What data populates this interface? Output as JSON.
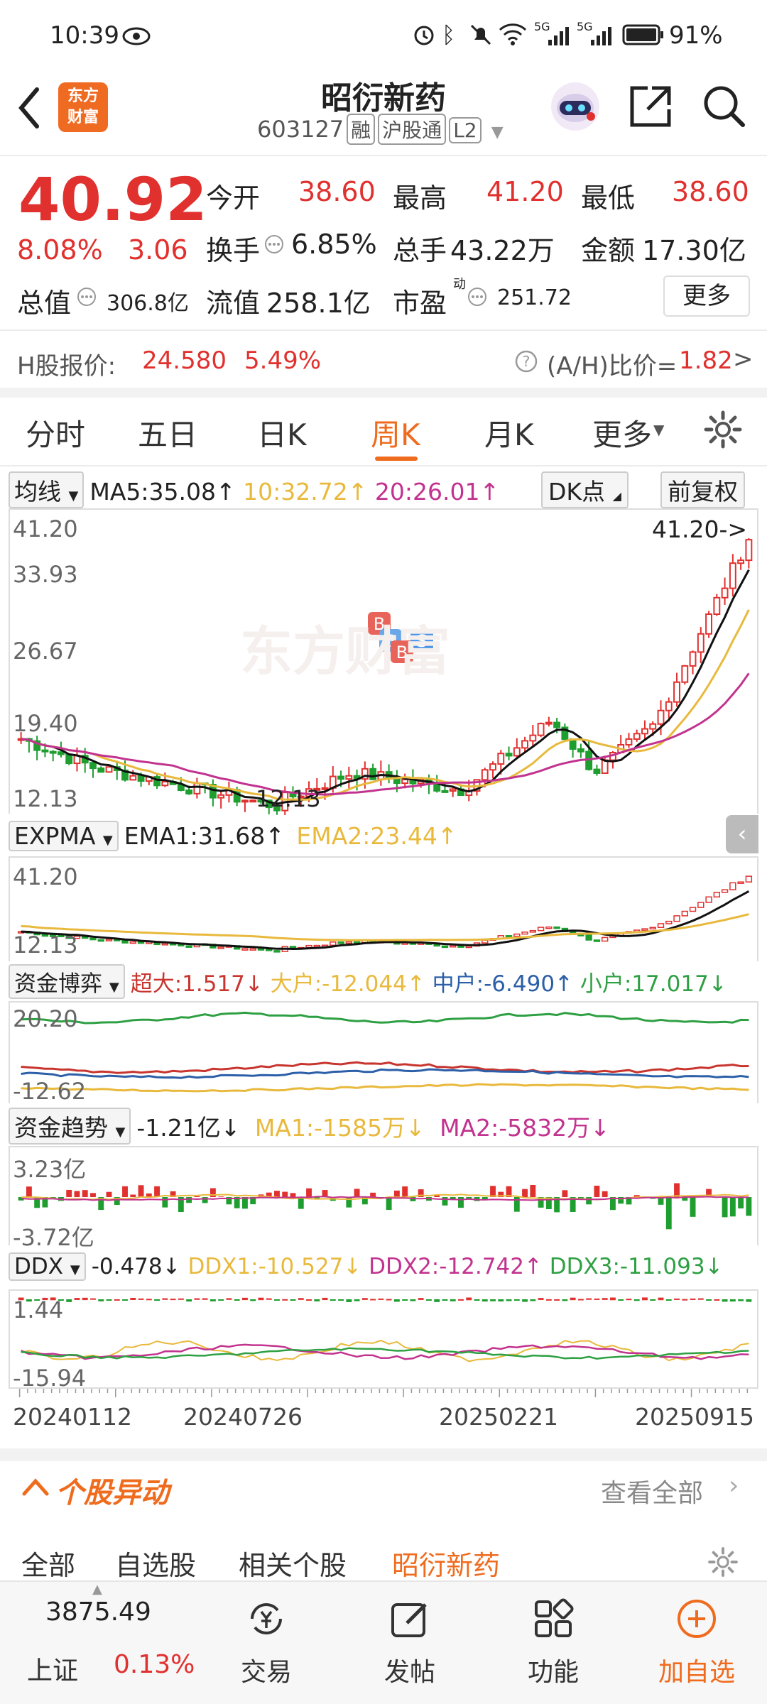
{
  "status": {
    "time": "10:39",
    "battery": "91%",
    "net_label_1": "5G",
    "net_label_2": "5G"
  },
  "header": {
    "title": "昭衍新药",
    "code": "603127",
    "tags": [
      "融",
      "沪股通",
      "L2"
    ],
    "logo_line1": "东方",
    "logo_line2": "财富"
  },
  "quote": {
    "price": "40.92",
    "pct": "8.08%",
    "chg": "3.06",
    "open_label": "今开",
    "open": "38.60",
    "high_label": "最高",
    "high": "41.20",
    "low_label": "最低",
    "low": "38.60",
    "turn_label": "换手",
    "turn": "6.85%",
    "vol_label": "总手",
    "vol": "43.22万",
    "amt_label": "金额",
    "amt": "17.30亿",
    "mcap_label": "总值",
    "mcap": "306.8亿",
    "float_label": "流值",
    "float": "258.1亿",
    "pe_label": "市盈",
    "pe_sup": "动",
    "pe": "251.72",
    "more": "更多"
  },
  "hshare": {
    "label": "H股报价:",
    "price": "24.580",
    "pct": "5.49%",
    "ratio_label": "(A/H)比价=",
    "ratio": "1.82"
  },
  "tabs": [
    "分时",
    "五日",
    "日K",
    "周K",
    "月K",
    "更多"
  ],
  "ma_row": {
    "sel": "均线",
    "ma5": "MA5:35.08↑",
    "ma10": "10:32.72↑",
    "ma20": "20:26.01↑",
    "dk": "DK点",
    "fq": "前复权"
  },
  "kline_axis": {
    "y1": "41.20",
    "y2": "33.93",
    "y3": "26.67",
    "y4": "19.40",
    "y5": "12.13",
    "max_tag": "41.20->",
    "min_tag": "12.13",
    "watermark": "东方财富"
  },
  "expma_row": {
    "sel": "EXPMA",
    "ema1": "EMA1:31.68↑",
    "ema2": "EMA2:23.44↑",
    "y_top": "41.20",
    "y_bot": "12.13"
  },
  "zjby_row": {
    "sel": "资金博弈",
    "cd": "超大:1.517↓",
    "dh": "大户:-12.044↑",
    "zh": "中户:-6.490↑",
    "xh": "小户:17.017↓",
    "y_top": "20.20",
    "y_bot": "-12.62"
  },
  "zjqs_row": {
    "sel": "资金趋势",
    "v": "-1.21亿↓",
    "ma1": "MA1:-1585万↓",
    "ma2": "MA2:-5832万↓",
    "y_top": "3.23亿",
    "y_bot": "-3.72亿"
  },
  "ddx_row": {
    "sel": "DDX",
    "v": "-0.478↓",
    "ddx1": "DDX1:-10.527↓",
    "ddx2": "DDX2:-12.742↑",
    "ddx3": "DDX3:-11.093↓",
    "y_top": "1.44",
    "y_bot": "-15.94"
  },
  "dates": [
    "20240112",
    "20240726",
    "20250221",
    "20250915"
  ],
  "news": {
    "title": "个股异动",
    "view_all": "查看全部",
    "tabs": [
      "全部",
      "自选股",
      "相关个股",
      "昭衍新药"
    ]
  },
  "bottom": {
    "index_value": "3875.49",
    "index_name": "上证",
    "index_pct": "0.13%",
    "items": [
      "交易",
      "发帖",
      "功能",
      "加自选"
    ]
  },
  "colors": {
    "up": "#e0312f",
    "down": "#1e9e2f",
    "accent": "#ef6b1d",
    "ma10": "#e8b93c",
    "ma20": "#c2338f"
  }
}
